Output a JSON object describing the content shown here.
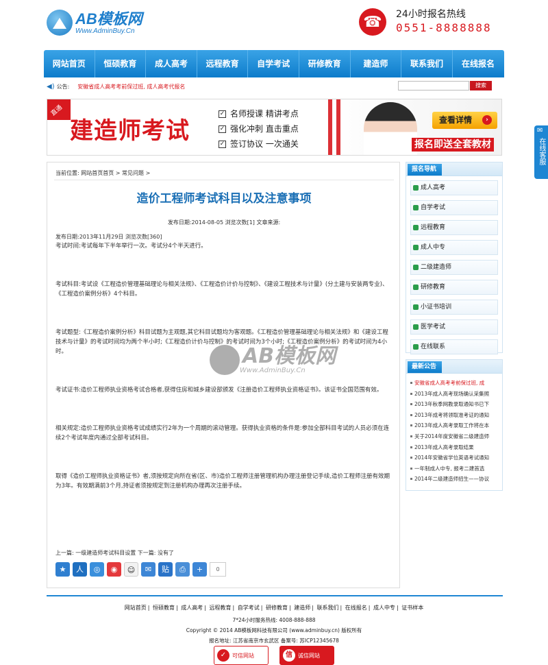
{
  "header": {
    "logo_title": "AB模板网",
    "logo_sub": "Www.AdminBuy.Cn",
    "hotline_label": "24小时报名热线",
    "hotline_number": "0551-8888888"
  },
  "nav": [
    "网站首页",
    "恒硕教育",
    "成人高考",
    "远程教育",
    "自学考试",
    "研修教育",
    "建造师",
    "联系我们",
    "在线报名"
  ],
  "notice": {
    "label": "公告:",
    "text": "安徽省成人高考考前保过班, 成人高考代报名",
    "search_placeholder": "",
    "search_btn": "搜索"
  },
  "banner": {
    "tag": "直通",
    "title": "建造师考试",
    "points": [
      "名师授课  精讲考点",
      "强化冲刺  直击重点",
      "签订协议  一次通关"
    ],
    "button": "查看详情",
    "bottom_text": "报名即送全套教材"
  },
  "float_bar": {
    "label": "在线客服"
  },
  "article": {
    "breadcrumb": "当前位置:  网站首页首页 >  常见问题 >",
    "title": "造价工程师考试科目以及注意事项",
    "meta": "发布日期:2014-08-05 浏览次数[1] 文章来源:",
    "info": "发布日期:2013年11月29日 浏览次数[360]",
    "paragraphs": [
      "考试时间:考试每年下半年举行一次。考试分4个半天进行。",
      "考试科目:考试设《工程造价管理基础理论与相关法规》、《工程造价计价与控制》、《建设工程技术与计量》(分土建与安装两专业)、《工程造价案例分析》4个科目。",
      "考试题型:《工程造价案例分析》科目试题为主观题,其它科目试题均为客观题。《工程造价管理基础理论与相关法规》和《建设工程技术与计量》的考试时间均为两个半小时;《工程造价计价与控制》的考试时间为3个小时;《工程造价案例分析》的考试时间为4小时。",
      "考试证书:造价工程师执业资格考试合格者,获得住房和城乡建设部颁发《注册造价工程师执业资格证书》。该证书全国范围有效。",
      "相关规定:造价工程师执业资格考试成绩实行2年为一个周期的滚动管理。获得执业资格的条件是:参加全部科目考试的人员必须在连续2个考试年度内通过全部考试科目。",
      "取得《造价工程师执业资格证书》者,须按规定向所在省(区、市)造价工程师注册管理机构办理注册登记手续,造价工程师注册有效期为3年。有效期满前3个月,持证者须按规定到注册机构办理再次注册手续。"
    ],
    "prev_next": "上一篇: 一级建造师考试科目设置  下一篇: 没有了",
    "share_count": "0",
    "watermark_title": "AB模板网",
    "watermark_sub": "Www.AdminBuy.Cn"
  },
  "sidebar": {
    "nav_title": "报名导航",
    "nav_items": [
      "成人高考",
      "自学考试",
      "远程教育",
      "成人中专",
      "二级建造师",
      "研修教育",
      "小证书培训",
      "医学考试",
      "在线联系"
    ],
    "news_title": "最新公告",
    "news_items": [
      "安徽省成人高考考前保过班, 成",
      "2013年成人高考现场确认采集照",
      "2013年秋季网教录取通知书已下",
      "2013年成考将领取准考证的通知",
      "2013年成人高考录取工作将在本",
      "关于2014年度安徽省二级建造师",
      "2013年成人高考录取结果",
      "2014年安徽省学位英语考试通知",
      "一年制成人中专, 报考二建首选",
      "2014年二级建造师招生——协议"
    ]
  },
  "footer": {
    "links": [
      "网站首页",
      "恒硕教育",
      "成人高考",
      "远程教育",
      "自学考试",
      "研修教育",
      "建造师",
      "联系我们",
      "在线报名",
      "成人中专",
      "证书样本"
    ],
    "service": "7*24小时服务热线: 4008-888-888",
    "copyright": "Copyright © 2014 AB模板网科技有限公司  (www.adminbuy.cn) 版权所有",
    "address": "报名地址: 江苏省南京市玄武区   备案号: 苏ICP12345678",
    "badge1": "可信网站",
    "badge2": "诚信网站"
  }
}
